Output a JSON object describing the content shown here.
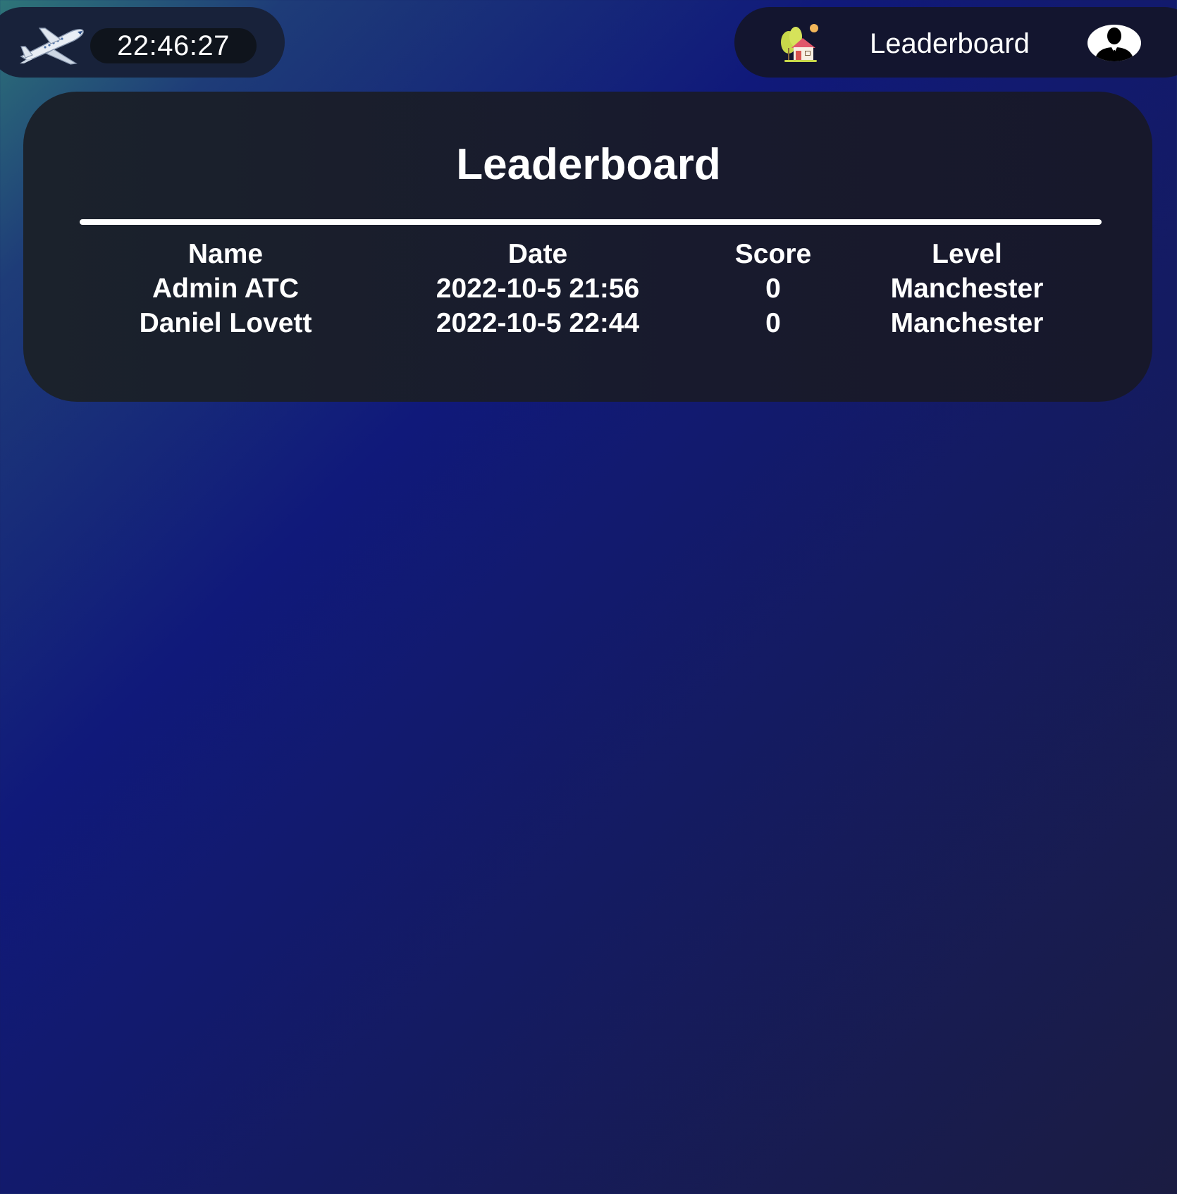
{
  "clock": {
    "time": "22:46:27",
    "icon": "airplane-icon"
  },
  "nav": {
    "home_icon": "home-icon",
    "leaderboard_label": "Leaderboard",
    "avatar_icon": "user-avatar-icon"
  },
  "leaderboard": {
    "title": "Leaderboard",
    "columns": [
      "Name",
      "Date",
      "Score",
      "Level"
    ],
    "rows": [
      {
        "name": "Admin ATC",
        "date": "2022-10-5 21:56",
        "score": "0",
        "level": "Manchester"
      },
      {
        "name": "Daniel Lovett",
        "date": "2022-10-5 22:44",
        "score": "0",
        "level": "Manchester"
      }
    ]
  },
  "colors": {
    "card_bg": "#1b222c",
    "pill_bg": "#18223a",
    "nav_bg": "#13152f",
    "accent_text": "#ffffff"
  }
}
